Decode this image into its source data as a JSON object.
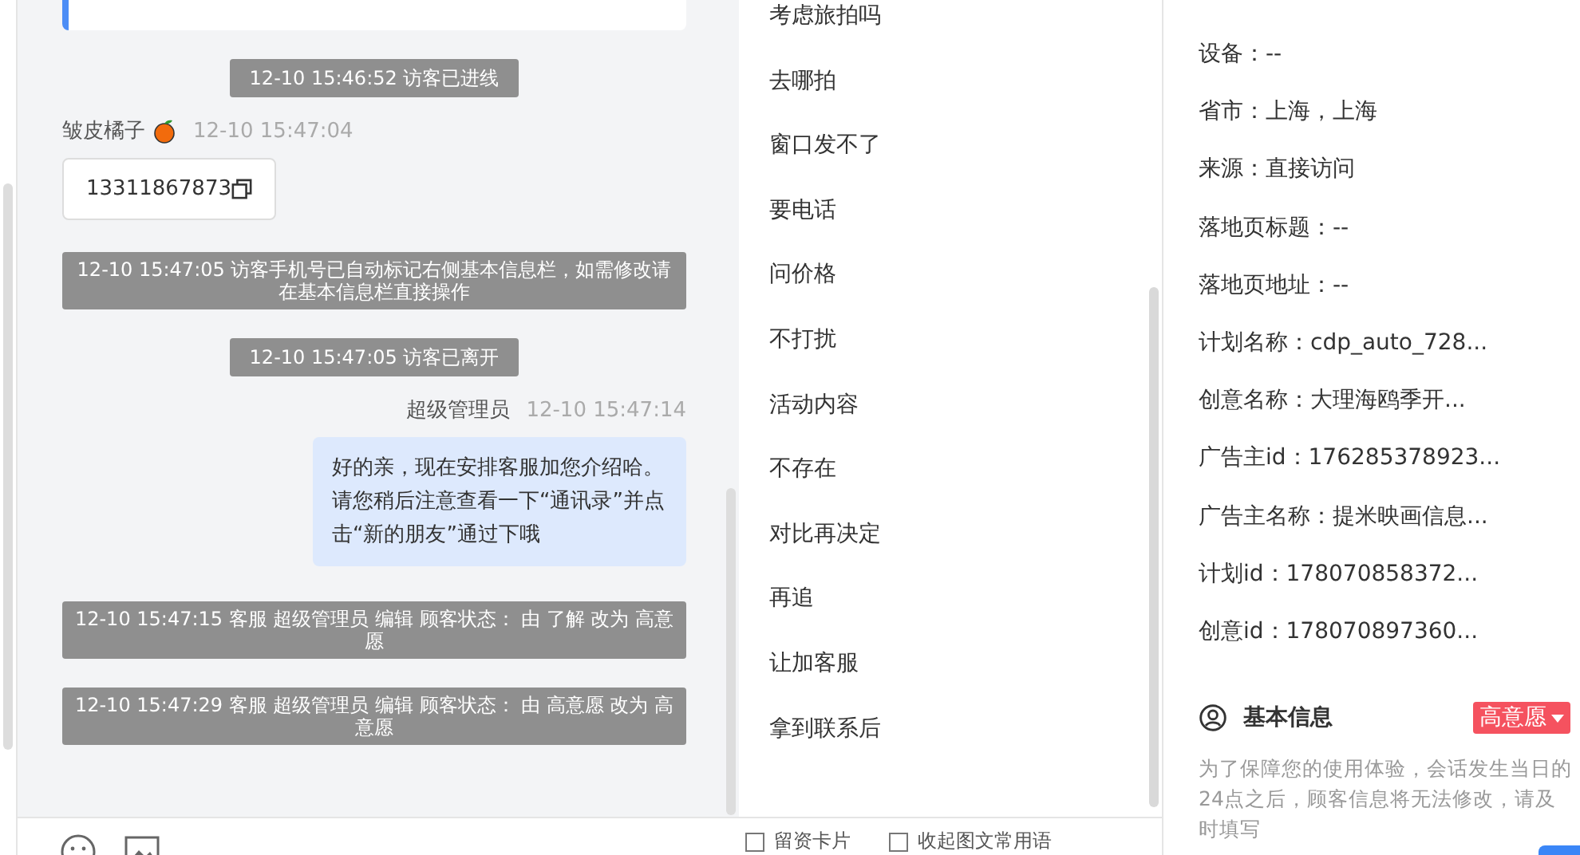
{
  "chat": {
    "messages": [
      {
        "kind": "system",
        "text": "12-10 15:46:52 访客已进线"
      },
      {
        "kind": "visitor",
        "sender": "皱皮橘子",
        "time": "12-10 15:47:04",
        "text": "13311867873"
      },
      {
        "kind": "notice",
        "text": "12-10 15:47:05 访客手机号已自动标记右侧基本信息栏，如需修改请在基本信息栏直接操作"
      },
      {
        "kind": "system",
        "text": "12-10 15:47:05 访客已离开"
      },
      {
        "kind": "agent",
        "sender": "超级管理员",
        "time": "12-10 15:47:14",
        "text": "好的亲，现在安排客服加您介绍哈。请您稍后注意查看一下“通讯录”并点击“新的朋友”通过下哦"
      },
      {
        "kind": "notice",
        "text": "12-10 15:47:15 客服 超级管理员 编辑 顾客状态： 由 了解 改为 高意愿"
      },
      {
        "kind": "notice",
        "text": "12-10 15:47:29 客服 超级管理员 编辑 顾客状态： 由 高意愿 改为 高意愿"
      }
    ]
  },
  "quick_replies": {
    "items": [
      "考虑旅拍吗",
      "去哪拍",
      "窗口发不了",
      "要电话",
      "问价格",
      "不打扰",
      "活动内容",
      "不存在",
      "对比再决定",
      "再追",
      "让加客服",
      "拿到联系后"
    ],
    "options": [
      {
        "label": "留资卡片",
        "checked": false
      },
      {
        "label": "收起图文常用语",
        "checked": false
      }
    ]
  },
  "info": {
    "fields": [
      "设备：--",
      "省市：上海，上海",
      "来源：直接访问",
      "落地页标题：--",
      "落地页地址：--",
      "计划名称：cdp_auto_728...",
      "创意名称：大理海鸥季开...",
      "广告主id：176285378923...",
      "广告主名称：提米映画信息...",
      "计划id：178070858372...",
      "创意id：178070897360..."
    ],
    "basic": {
      "title": "基本信息",
      "status": "高意愿",
      "note": "为了保障您的使用体验，会话发生当日的24点之后，顾客信息将无法修改，请及时填写"
    }
  }
}
